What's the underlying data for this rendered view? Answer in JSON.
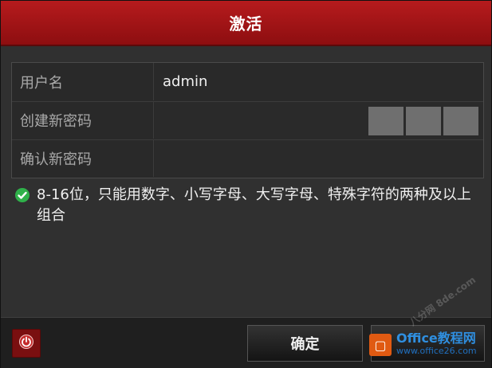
{
  "dialog": {
    "title": "激活"
  },
  "form": {
    "username_label": "用户名",
    "username_value": "admin",
    "new_password_label": "创建新密码",
    "confirm_password_label": "确认新密码",
    "strength_segments": 3
  },
  "hint": {
    "text": "8-16位，只能用数字、小写字母、大写字母、特殊字符的两种及以上组合",
    "icon": "check-circle-icon"
  },
  "footer": {
    "confirm_label": "确定"
  },
  "watermark": {
    "line1": "Office教程网",
    "line2": "www.office26.com",
    "diag_text": "八分网 8de.com"
  },
  "colors": {
    "title_bar": "#a51618",
    "power_button": "#7a0f10",
    "check": "#2fb14a"
  }
}
